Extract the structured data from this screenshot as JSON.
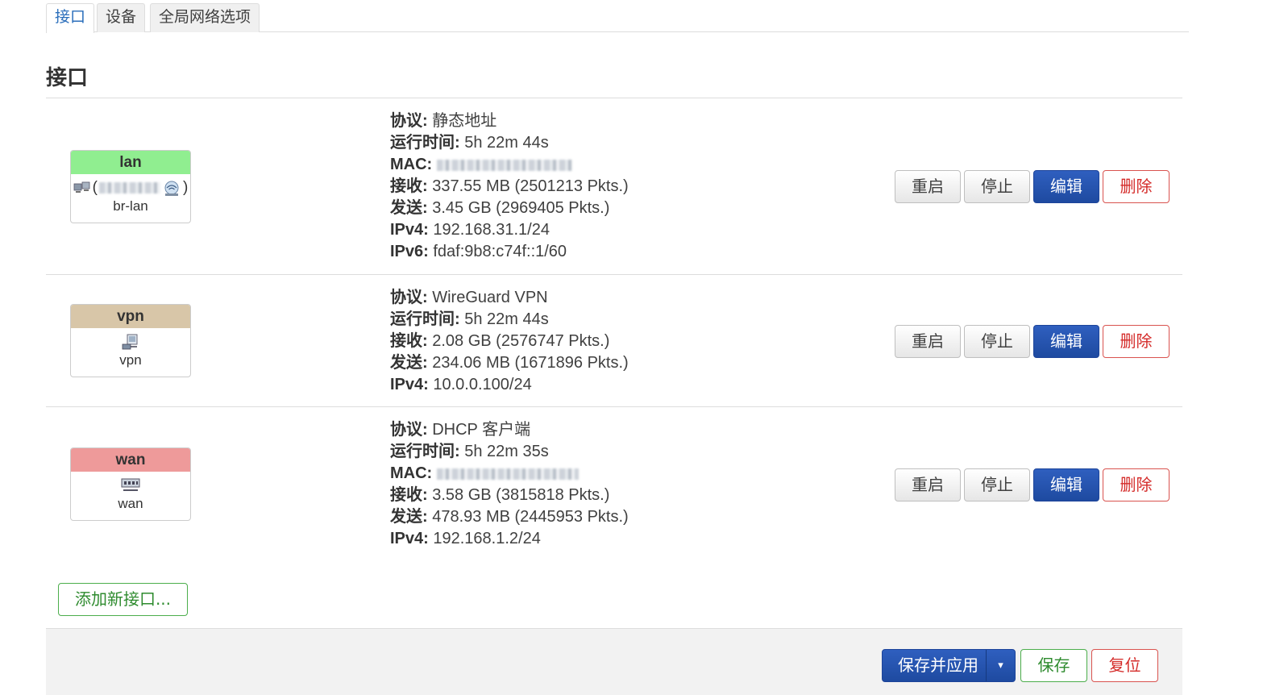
{
  "tabs": [
    "接口",
    "设备",
    "全局网络选项"
  ],
  "section_title": "接口",
  "interfaces": [
    {
      "name": "lan",
      "color": "#90ee90",
      "device": "br-lan",
      "rows": [
        {
          "label": "协议:",
          "value": " 静态地址"
        },
        {
          "label": "运行时间:",
          "value": " 5h 22m 44s"
        },
        {
          "label": "MAC:",
          "value": ""
        },
        {
          "label": "接收:",
          "value": " 337.55 MB (2501213 Pkts.)"
        },
        {
          "label": "发送:",
          "value": " 3.45 GB (2969405 Pkts.)"
        },
        {
          "label": "IPv4:",
          "value": " 192.168.31.1/24"
        },
        {
          "label": "IPv6:",
          "value": " fdaf:9b8:c74f::1/60"
        }
      ]
    },
    {
      "name": "vpn",
      "color": "#d8c6a8",
      "device": "vpn",
      "rows": [
        {
          "label": "协议:",
          "value": " WireGuard VPN"
        },
        {
          "label": "运行时间:",
          "value": " 5h 22m 44s"
        },
        {
          "label": "接收:",
          "value": " 2.08 GB (2576747 Pkts.)"
        },
        {
          "label": "发送:",
          "value": " 234.06 MB (1671896 Pkts.)"
        },
        {
          "label": "IPv4:",
          "value": " 10.0.0.100/24"
        }
      ]
    },
    {
      "name": "wan",
      "color": "#ee9a9a",
      "device": "wan",
      "rows": [
        {
          "label": "协议:",
          "value": " DHCP 客户端"
        },
        {
          "label": "运行时间:",
          "value": " 5h 22m 35s"
        },
        {
          "label": "MAC:",
          "value": ""
        },
        {
          "label": "接收:",
          "value": " 3.58 GB (3815818 Pkts.)"
        },
        {
          "label": "发送:",
          "value": " 478.93 MB (2445953 Pkts.)"
        },
        {
          "label": "IPv4:",
          "value": " 192.168.1.2/24"
        }
      ]
    }
  ],
  "row_buttons": {
    "restart": "重启",
    "stop": "停止",
    "edit": "编辑",
    "delete": "删除"
  },
  "add_interface": "添加新接口...",
  "footer": {
    "save_apply": "保存并应用",
    "save": "保存",
    "reset": "复位",
    "dropdown_icon": "caret-down-icon"
  }
}
